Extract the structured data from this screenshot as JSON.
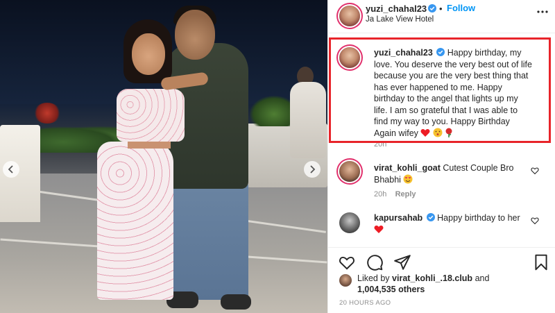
{
  "post": {
    "author": "yuzi_chahal23",
    "follow_label": "Follow",
    "separator": "•",
    "location": "Ja Lake View Hotel"
  },
  "caption": {
    "username": "yuzi_chahal23",
    "text": "Happy birthday, my love. You deserve the very best out of life because you are the very best thing that has ever happened to me. Happy birthday to the angel that lights up my life. I am so grateful that I was able to find my way to you. Happy Birthday Again wifey",
    "age": "20h"
  },
  "comments": [
    {
      "username": "virat_kohli_goat",
      "text": "Cutest Couple Bro Bhabhi",
      "reply_label": "Reply",
      "age": "20h"
    },
    {
      "username": "kapursahab",
      "text": "Happy birthday to her"
    }
  ],
  "likes": {
    "prefix": "Liked by",
    "liker": "virat_kohli_.18.club",
    "and_label": "and",
    "count": "1,004,535 others"
  },
  "timestamp": "20 HOURS AGO",
  "colors": {
    "accent_blue": "#0095f6",
    "highlight_red": "#e8242a",
    "heart_red": "#ed1c24",
    "text_dark": "#262626",
    "text_muted": "#8e8e8e"
  },
  "icons": [
    "carousel-prev-icon",
    "carousel-next-icon",
    "verified-icon",
    "more-icon",
    "heart-icon",
    "comment-icon",
    "share-icon",
    "bookmark-icon"
  ]
}
